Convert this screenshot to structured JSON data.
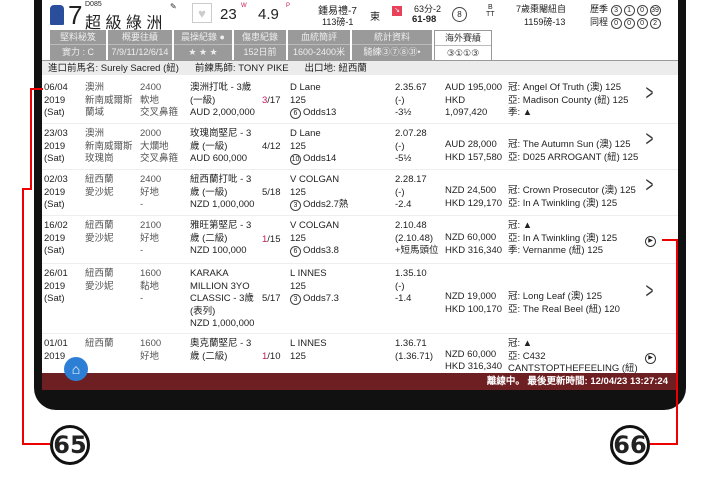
{
  "header": {
    "horse_no": "7",
    "code": "D085",
    "name": "超 級 綠 洲",
    "rating": "23",
    "rating_sup": "W",
    "odds": "4.9",
    "odds_sup": "P",
    "jockey": "鍾易禮-7",
    "weight": "113磅-1",
    "draw_side": "東",
    "score": "63分-2",
    "score_range": "61-98",
    "draw": "8",
    "gear_top": "B",
    "gear_bottom": "TT",
    "age_desc": "7歲棗閹紐自",
    "body_weight": "1159磅-13",
    "season_label": "歷季",
    "season_stats": [
      "3",
      "1",
      "0",
      "39"
    ],
    "course_label": "同程",
    "course_stats": [
      "0",
      "0",
      "0",
      "2"
    ]
  },
  "tabs": [
    {
      "top": "堅料秘笈",
      "bottom": "實力 : C"
    },
    {
      "top": "概要往績",
      "bottom": "7/9/11/12/6/14"
    },
    {
      "top": "晨操紀錄 ●",
      "bottom": "★ ★ ★"
    },
    {
      "top": "傷患紀錄",
      "bottom": "152日前"
    },
    {
      "top": "血統簡評",
      "bottom": "1600-2400米"
    },
    {
      "top": "統計資料",
      "bottom": "騎練③⑦⑧㉛•"
    },
    {
      "top": "海外賽績",
      "bottom": "③①①③"
    }
  ],
  "info": {
    "import_name": "進口前馬名: Surely Sacred (紐)",
    "prev_trainer": "前練馬師: TONY PIKE",
    "origin": "出口地: 紐西蘭"
  },
  "rows": [
    {
      "date": [
        "06/04",
        "2019",
        "(Sat)"
      ],
      "venue": [
        "澳洲",
        "新南威爾斯",
        "蘭域"
      ],
      "track": [
        "2400",
        "軟地",
        "交叉鼻箍"
      ],
      "race": [
        "澳洲打吡 - 3歲",
        "(一級)",
        "AUD 2,000,000"
      ],
      "place_a": "3",
      "place_b": "/17",
      "jockey": "D Lane",
      "wt": "125",
      "draw": "6",
      "odds": "Odds13",
      "time": [
        "2.35.67",
        "(-)",
        "-3½"
      ],
      "prize": [
        "AUD 195,000",
        "HKD",
        "1,097,420"
      ],
      "results": [
        "冠: Angel Of Truth (澳) 125",
        "亞: Madison County (紐) 125",
        "季: ▲"
      ],
      "action": "chevron"
    },
    {
      "date": [
        "23/03",
        "2019",
        "(Sat)"
      ],
      "venue": [
        "澳洲",
        "新南威爾斯",
        "玫瑰崗"
      ],
      "track": [
        "2000",
        "大爛地",
        "交叉鼻箍"
      ],
      "race": [
        "玫瑰崗堅尼 - 3",
        "歲 (一級)",
        "AUD 600,000"
      ],
      "place_a": "",
      "place_b": "4/12",
      "jockey": "D Lane",
      "wt": "125",
      "draw": "10",
      "odds": "Odds14",
      "time": [
        "2.07.28",
        "(-)",
        "-5½"
      ],
      "prize": [
        "AUD 28,000",
        "HKD 157,580"
      ],
      "results": [
        "冠: The Autumn Sun (澳) 125",
        "亞: D025 ARROGANT (紐) 125"
      ],
      "action": "chevron"
    },
    {
      "date": [
        "02/03",
        "2019",
        "(Sat)"
      ],
      "venue": [
        "紐西蘭",
        "愛沙妮"
      ],
      "track": [
        "2400",
        "好地",
        "-"
      ],
      "race": [
        "紐西蘭打吡 - 3",
        "歲 (一級)",
        "NZD 1,000,000"
      ],
      "place_a": "",
      "place_b": "5/18",
      "jockey": "V COLGAN",
      "wt": "125",
      "draw": "3",
      "odds": "Odds2.7熱",
      "time": [
        "2.28.17",
        "(-)",
        "-2.4"
      ],
      "prize": [
        "NZD 24,500",
        "HKD 129,170"
      ],
      "results": [
        "冠: Crown Prosecutor (澳) 125",
        "亞: In A Twinkling (澳) 125"
      ],
      "action": "chevron"
    },
    {
      "date": [
        "16/02",
        "2019",
        "(Sat)"
      ],
      "venue": [
        "紐西蘭",
        "愛沙妮"
      ],
      "track": [
        "2100",
        "好地",
        "-"
      ],
      "race": [
        "雅旺第堅尼 - 3",
        "歲 (二級)",
        "NZD 100,000"
      ],
      "place_a": "1",
      "place_b": "/15",
      "jockey": "V COLGAN",
      "wt": "125",
      "draw": "6",
      "odds": "Odds3.8",
      "time": [
        "2.10.48",
        "(2.10.48)",
        "+短馬頭位"
      ],
      "prize": [
        "NZD 60,000",
        "HKD 316,340"
      ],
      "results": [
        "冠: ▲",
        "亞: In A Twinkling (澳) 125",
        "季: Vernanme (紐) 125"
      ],
      "action": "play"
    },
    {
      "date": [
        "26/01",
        "2019",
        "(Sat)"
      ],
      "venue": [
        "紐西蘭",
        "愛沙妮"
      ],
      "track": [
        "1600",
        "黏地",
        "-"
      ],
      "race": [
        "KARAKA",
        "MILLION 3YO",
        "CLASSIC - 3歲",
        "(表列)",
        "NZD 1,000,000"
      ],
      "place_a": "",
      "place_b": "5/17",
      "jockey": "L INNES",
      "wt": "125",
      "draw": "3",
      "odds": "Odds7.3",
      "time": [
        "1.35.10",
        "(-)",
        "-1.4"
      ],
      "prize": [
        "NZD 19,000",
        "HKD 100,170"
      ],
      "results": [
        "冠: Long Leaf (澳) 125",
        "亞: The Real Beel (紐) 120"
      ],
      "action": "chevron"
    },
    {
      "date": [
        "01/01",
        "2019"
      ],
      "venue": [
        "紐西蘭"
      ],
      "track": [
        "1600",
        "好地"
      ],
      "race": [
        "奧克蘭堅尼 - 3",
        "歲 (二級)"
      ],
      "place_a": "1",
      "place_b": "/10",
      "jockey": "L INNES",
      "wt": "125",
      "draw": "",
      "odds": "",
      "time": [
        "1.36.71",
        "(1.36.71)"
      ],
      "prize": [
        "NZD 60,000",
        "HKD 316,340"
      ],
      "results": [
        "冠: ▲",
        "亞: C432",
        "CANTSTOPTHEFEELING (紐)"
      ],
      "action": "play"
    }
  ],
  "status": "離線中。 最後更新時間: 12/04/23 13:27:24",
  "callouts": {
    "left": "65",
    "right": "66"
  },
  "colors": {
    "status_bar": "#6e1f22",
    "accent_place": "#c2185b",
    "callout": "#e00000",
    "home": "#2d7fd6"
  }
}
